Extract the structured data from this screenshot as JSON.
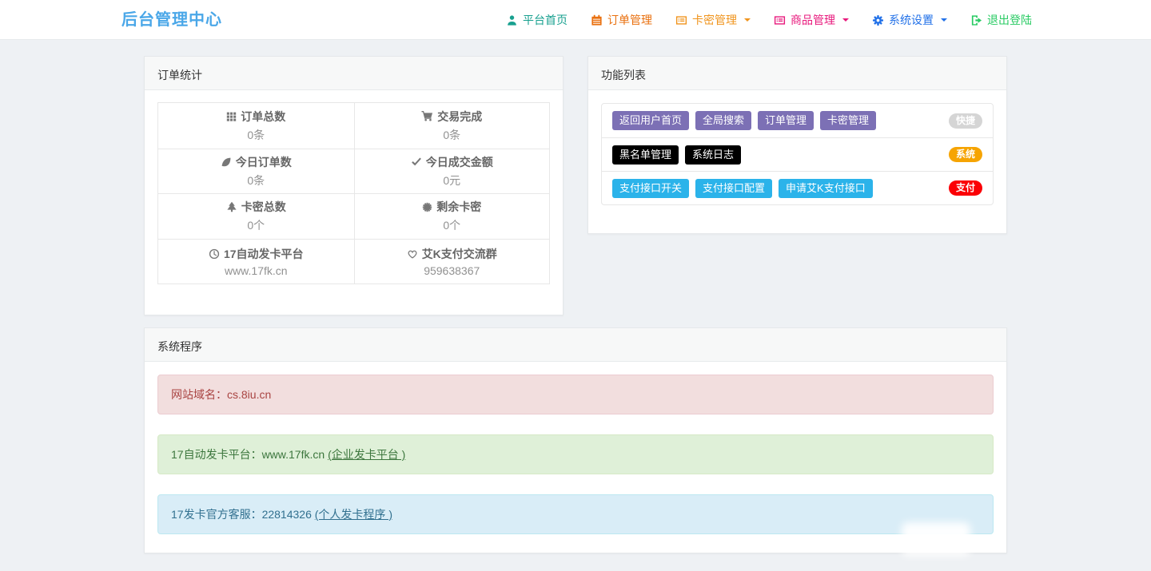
{
  "header": {
    "title": "后台管理中心",
    "nav": [
      {
        "label": "平台首页",
        "icon": "user-icon",
        "color": "#18a08f",
        "dropdown": false
      },
      {
        "label": "订单管理",
        "icon": "calendar-icon",
        "color": "#e9700f",
        "dropdown": false
      },
      {
        "label": "卡密管理",
        "icon": "list-alt-icon",
        "color": "#f0941d",
        "dropdown": true
      },
      {
        "label": "商品管理",
        "icon": "list-alt-icon",
        "color": "#e8187c",
        "dropdown": true
      },
      {
        "label": "系统设置",
        "icon": "gear-icon",
        "color": "#2271e8",
        "dropdown": true
      },
      {
        "label": "退出登陆",
        "icon": "sign-out-icon",
        "color": "#28cb63",
        "dropdown": false
      }
    ]
  },
  "order_stats": {
    "title": "订单统计",
    "cells": [
      {
        "icon": "th-grid-icon",
        "label": "订单总数",
        "value": "0条"
      },
      {
        "icon": "cart-icon",
        "label": "交易完成",
        "value": "0条"
      },
      {
        "icon": "leaf-icon",
        "label": "今日订单数",
        "value": "0条"
      },
      {
        "icon": "check-icon",
        "label": "今日成交金额",
        "value": "0元"
      },
      {
        "icon": "tree-icon",
        "label": "卡密总数",
        "value": "0个"
      },
      {
        "icon": "certificate-icon",
        "label": "剩余卡密",
        "value": "0个"
      },
      {
        "icon": "clock-icon",
        "label": "17自动发卡平台",
        "value": "www.17fk.cn"
      },
      {
        "icon": "heart-icon",
        "label": "艾K支付交流群",
        "value": "959638367"
      }
    ]
  },
  "function_list": {
    "title": "功能列表",
    "rows": [
      {
        "buttons": [
          "返回用户首页",
          "全局搜索",
          "订单管理",
          "卡密管理"
        ],
        "badge": "快捷",
        "badge_color": "#d5d5d5",
        "button_color": "#7c70b5"
      },
      {
        "buttons": [
          "黑名单管理",
          "系统日志"
        ],
        "badge": "系统",
        "badge_color": "#f6a402",
        "button_color": "#000000"
      },
      {
        "buttons": [
          "支付接口开关",
          "支付接口配置",
          "申请艾K支付接口"
        ],
        "badge": "支付",
        "badge_color": "#fb0006",
        "button_color": "#2bb3ea"
      }
    ]
  },
  "system_program": {
    "title": "系统程序",
    "alerts": [
      {
        "type": "danger",
        "text": "网站域名：cs.8iu.cn",
        "link": ""
      },
      {
        "type": "success",
        "text": "17自动发卡平台：www.17fk.cn ",
        "link": "(企业发卡平台 )"
      },
      {
        "type": "info",
        "text": "17发卡官方客服：22814326 ",
        "link": "(个人发卡程序 )"
      }
    ]
  },
  "colors": {
    "page_bg": "#eef1f4",
    "brand_title": "#4aa7e8",
    "alert_danger_text": "#a94442",
    "alert_success_text": "#3c763d",
    "alert_info_text": "#31708f"
  }
}
